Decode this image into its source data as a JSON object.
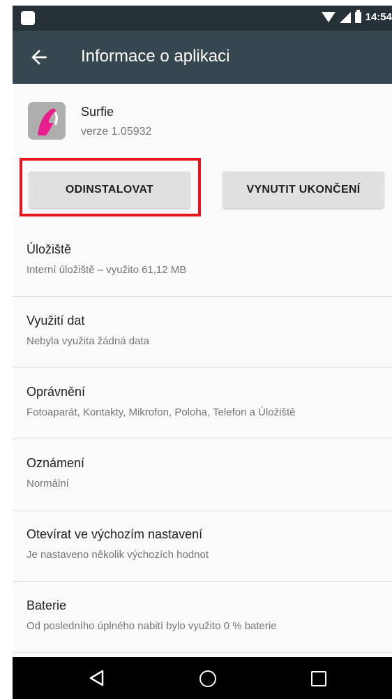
{
  "status_bar": {
    "time": "14:54"
  },
  "app_bar": {
    "title": "Informace o aplikaci"
  },
  "app": {
    "name": "Surfie",
    "version": "verze 1.05932"
  },
  "buttons": {
    "uninstall": "ODINSTALOVAT",
    "force_stop": "VYNUTIT UKONČENÍ"
  },
  "settings": [
    {
      "title": "Úložiště",
      "subtitle": "Interní úložiště – využito 61,12 MB"
    },
    {
      "title": "Využití dat",
      "subtitle": "Nebyla využita žádná data"
    },
    {
      "title": "Oprávnění",
      "subtitle": "Fotoaparát, Kontakty, Mikrofon, Poloha, Telefon a Úložiště"
    },
    {
      "title": "Oznámení",
      "subtitle": "Normální"
    },
    {
      "title": "Otevírat ve výchozím nastavení",
      "subtitle": "Je nastaveno několik výchozích hodnot"
    },
    {
      "title": "Baterie",
      "subtitle": "Od posledního úplného nabití bylo využito 0 % baterie"
    }
  ],
  "colors": {
    "status_bar": "#263238",
    "app_bar": "#37474f",
    "highlight_border": "#e8131b",
    "app_icon_pink": "#e91e8c"
  },
  "icons": {
    "back": "arrow-left-icon",
    "nav_back": "triangle-back-icon",
    "nav_home": "circle-home-icon",
    "nav_recent": "square-recent-icon"
  }
}
